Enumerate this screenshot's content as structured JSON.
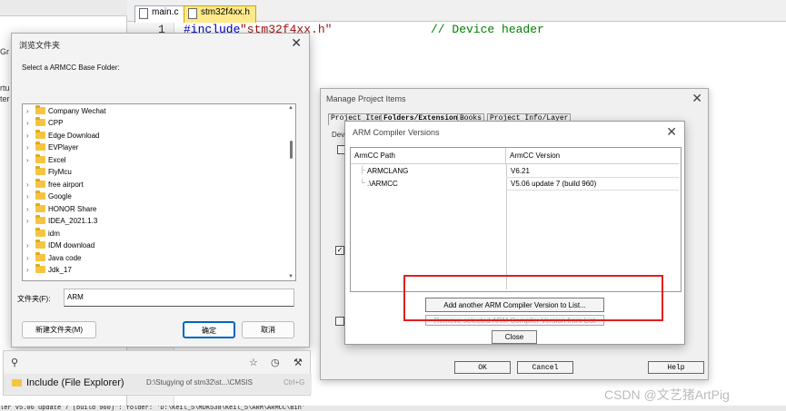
{
  "editor": {
    "tabs": [
      {
        "label": "main.c"
      },
      {
        "label": "stm32f4xx.h"
      }
    ],
    "line_number": "1",
    "code_include": "#include",
    "code_string": "\"stm32f4xx.h\"",
    "code_comment": "// Device header"
  },
  "leftpane": {
    "fragments": [
      "Gr",
      "rtu",
      "ter"
    ]
  },
  "manage_dialog": {
    "title": "Manage Project Items",
    "tabs": [
      "Project Items",
      "Folders/Extensions",
      "Books",
      "Project Info/Layer"
    ],
    "dev_label": "Devi",
    "ok": "OK",
    "cancel": "Cancel",
    "help": "Help"
  },
  "arm_dialog": {
    "title": "ARM Compiler Versions",
    "col_path": "ArmCC Path",
    "col_version": "ArmCC Version",
    "rows": [
      {
        "path": "ARMCLANG",
        "version": "V6.21"
      },
      {
        "path": ".\\ARMCC",
        "version": "V5.06 update 7 (build 960)"
      }
    ],
    "add_button": "Add another ARM Compiler Version to List...",
    "remove_button": "Remove selected ARM Compiler Version from List",
    "close_button": "Close"
  },
  "browse_dialog": {
    "title": "浏览文件夹",
    "prompt": "Select a ARMCC Base Folder:",
    "folders": [
      {
        "label": "Company Wechat",
        "expandable": true
      },
      {
        "label": "CPP",
        "expandable": true
      },
      {
        "label": "Edge Download",
        "expandable": true
      },
      {
        "label": "EVPlayer",
        "expandable": true
      },
      {
        "label": "Excel",
        "expandable": true
      },
      {
        "label": "FlyMcu",
        "expandable": false
      },
      {
        "label": "free airport",
        "expandable": true
      },
      {
        "label": "Google",
        "expandable": true
      },
      {
        "label": "HONOR Share",
        "expandable": true
      },
      {
        "label": "IDEA_2021.1.3",
        "expandable": true
      },
      {
        "label": "idm",
        "expandable": false
      },
      {
        "label": "IDM download",
        "expandable": true
      },
      {
        "label": "Java code",
        "expandable": true
      },
      {
        "label": "Jdk_17",
        "expandable": true
      }
    ],
    "folder_label": "文件夹(F):",
    "folder_value": "ARM",
    "new_folder_button": "新建文件夹(M)",
    "ok_button": "确定",
    "cancel_button": "取消"
  },
  "autocomplete": {
    "item_name": "Include (File Explorer)",
    "item_path": "D:\\Stugying of stm32\\st...\\CMSIS",
    "shortcut": "Ctrl+G"
  },
  "status_bar": {
    "text": "ler V5.06 update 7 (build 960)': folder: 'D:\\Keil_5\\MDK538\\Keil_5\\ARM\\ARMCC\\Bin'"
  },
  "watermark": "CSDN @文艺猪ArtPig"
}
